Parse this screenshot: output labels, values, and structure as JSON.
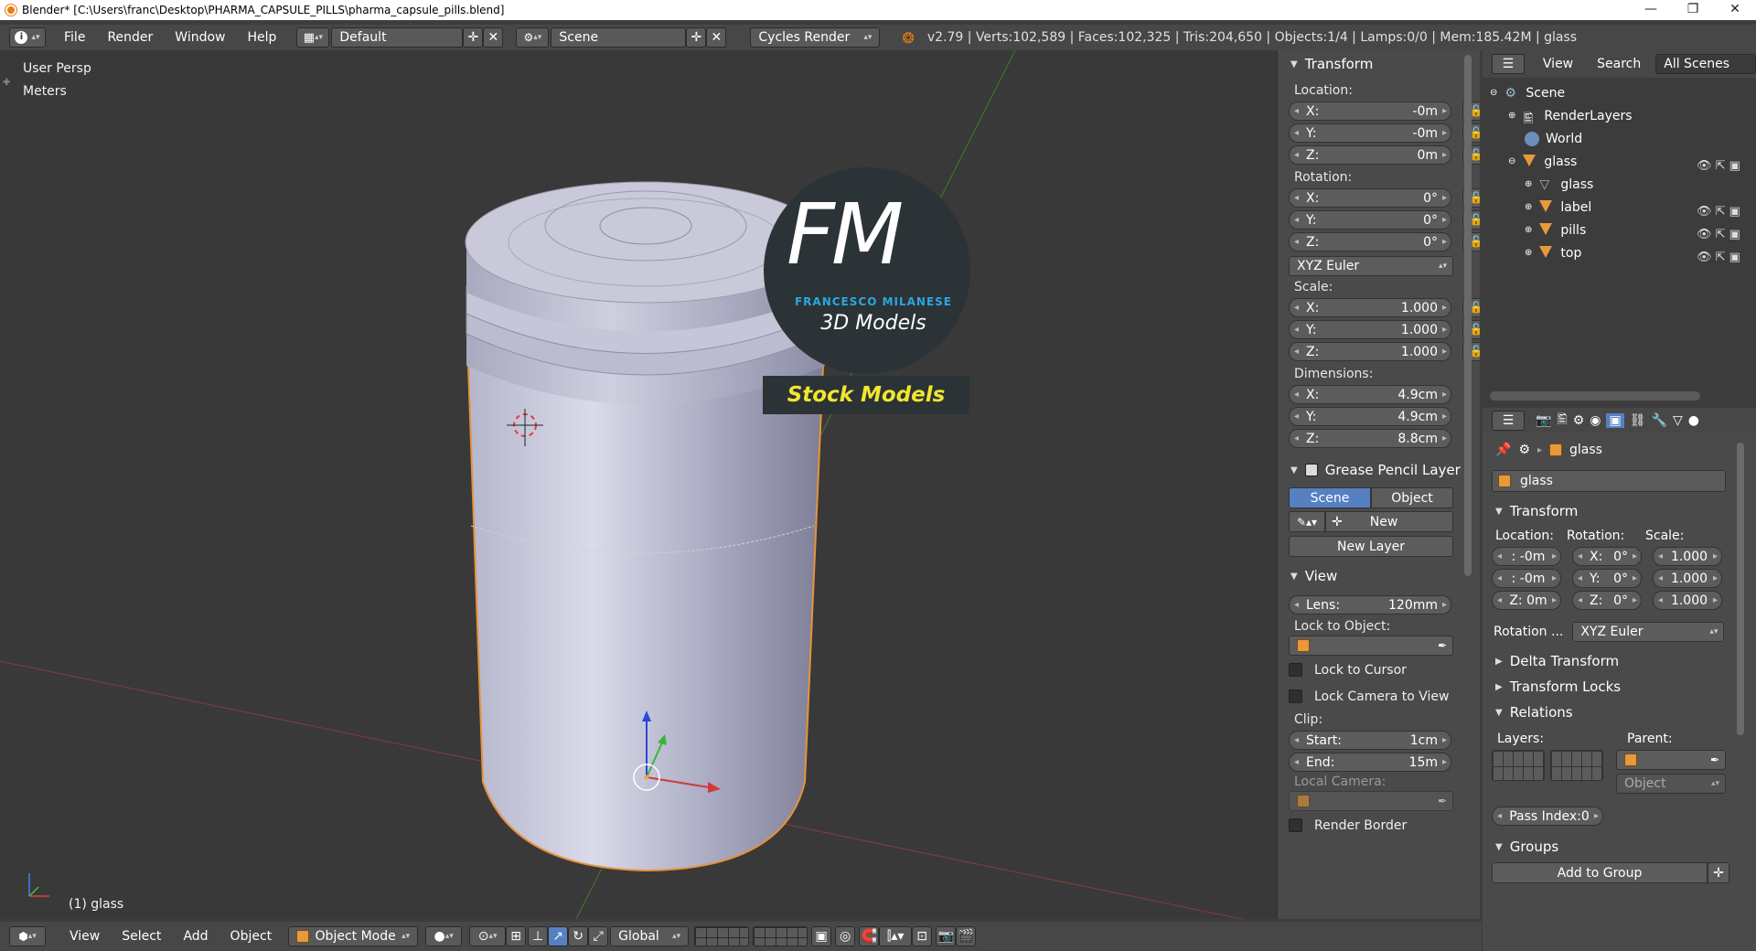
{
  "window": {
    "title": "Blender* [C:\\Users\\franc\\Desktop\\PHARMA_CAPSULE_PILLS\\pharma_capsule_pills.blend]",
    "minimize": "—",
    "maximize": "❐",
    "close": "✕"
  },
  "infobar": {
    "menus": [
      "File",
      "Render",
      "Window",
      "Help"
    ],
    "screen_layout": "Default",
    "scene": "Scene",
    "render_engine": "Cycles Render",
    "stats": "v2.79 | Verts:102,589 | Faces:102,325 | Tris:204,650 | Objects:1/4 | Lamps:0/0 | Mem:185.42M | glass"
  },
  "viewport": {
    "view_name": "User Persp",
    "units": "Meters",
    "object_label": "(1) glass",
    "watermark": {
      "initials": "FM",
      "name": "FRANCESCO MILANESE",
      "subtitle": "3D Models",
      "banner": "Stock Models"
    }
  },
  "npanel": {
    "transform": {
      "title": "Transform",
      "location_label": "Location:",
      "location": [
        {
          "axis": "X:",
          "value": "-0m"
        },
        {
          "axis": "Y:",
          "value": "-0m"
        },
        {
          "axis": "Z:",
          "value": "0m"
        }
      ],
      "rotation_label": "Rotation:",
      "rotation": [
        {
          "axis": "X:",
          "value": "0°"
        },
        {
          "axis": "Y:",
          "value": "0°"
        },
        {
          "axis": "Z:",
          "value": "0°"
        }
      ],
      "rotation_mode": "XYZ Euler",
      "scale_label": "Scale:",
      "scale": [
        {
          "axis": "X:",
          "value": "1.000"
        },
        {
          "axis": "Y:",
          "value": "1.000"
        },
        {
          "axis": "Z:",
          "value": "1.000"
        }
      ],
      "dimensions_label": "Dimensions:",
      "dimensions": [
        {
          "axis": "X:",
          "value": "4.9cm"
        },
        {
          "axis": "Y:",
          "value": "4.9cm"
        },
        {
          "axis": "Z:",
          "value": "8.8cm"
        }
      ]
    },
    "grease_pencil": {
      "title": "Grease Pencil Layer",
      "tab_scene": "Scene",
      "tab_object": "Object",
      "new_label": "New",
      "new_layer_label": "New Layer"
    },
    "view": {
      "title": "View",
      "lens_label": "Lens:",
      "lens_value": "120mm",
      "lock_to_object_label": "Lock to Object:",
      "lock_to_cursor": "Lock to Cursor",
      "lock_camera_to_view": "Lock Camera to View",
      "clip_label": "Clip:",
      "clip_start_label": "Start:",
      "clip_start_value": "1cm",
      "clip_end_label": "End:",
      "clip_end_value": "15m",
      "local_camera_label": "Local Camera:",
      "render_border": "Render Border"
    }
  },
  "outliner": {
    "header": {
      "view": "View",
      "search": "Search",
      "filter": "All Scenes"
    },
    "items": [
      {
        "label": "Scene"
      },
      {
        "label": "RenderLayers"
      },
      {
        "label": "World"
      },
      {
        "label": "glass"
      },
      {
        "label": "glass"
      },
      {
        "label": "label"
      },
      {
        "label": "pills"
      },
      {
        "label": "top"
      }
    ]
  },
  "properties": {
    "context_object": "glass",
    "object_name": "glass",
    "transform_title": "Transform",
    "location_label": "Location:",
    "rotation_label": "Rotation:",
    "scale_label": "Scale:",
    "location": [
      ": -0m",
      ": -0m",
      "Z: 0m"
    ],
    "rotation": [
      {
        "axis": "X:",
        "value": "0°"
      },
      {
        "axis": "Y:",
        "value": "0°"
      },
      {
        "axis": "Z:",
        "value": "0°"
      }
    ],
    "scale": [
      "1.000",
      "1.000",
      "1.000"
    ],
    "rotation_mode_label": "Rotation ...",
    "rotation_mode": "XYZ Euler",
    "delta_transform": "Delta Transform",
    "transform_locks": "Transform Locks",
    "relations": "Relations",
    "layers_label": "Layers:",
    "parent_label": "Parent:",
    "parent_type": "Object",
    "pass_index": "Pass Index:0",
    "groups": "Groups",
    "add_to_group": "Add to Group"
  },
  "bottombar": {
    "menus": [
      "View",
      "Select",
      "Add",
      "Object"
    ],
    "mode": "Object Mode",
    "orientation": "Global"
  },
  "colors": {
    "accent_blue": "#5680c2",
    "watermark_cyan": "#2aa7e0",
    "banner_yellow": "#f0e62e",
    "selection_orange": "#e79a3c"
  }
}
